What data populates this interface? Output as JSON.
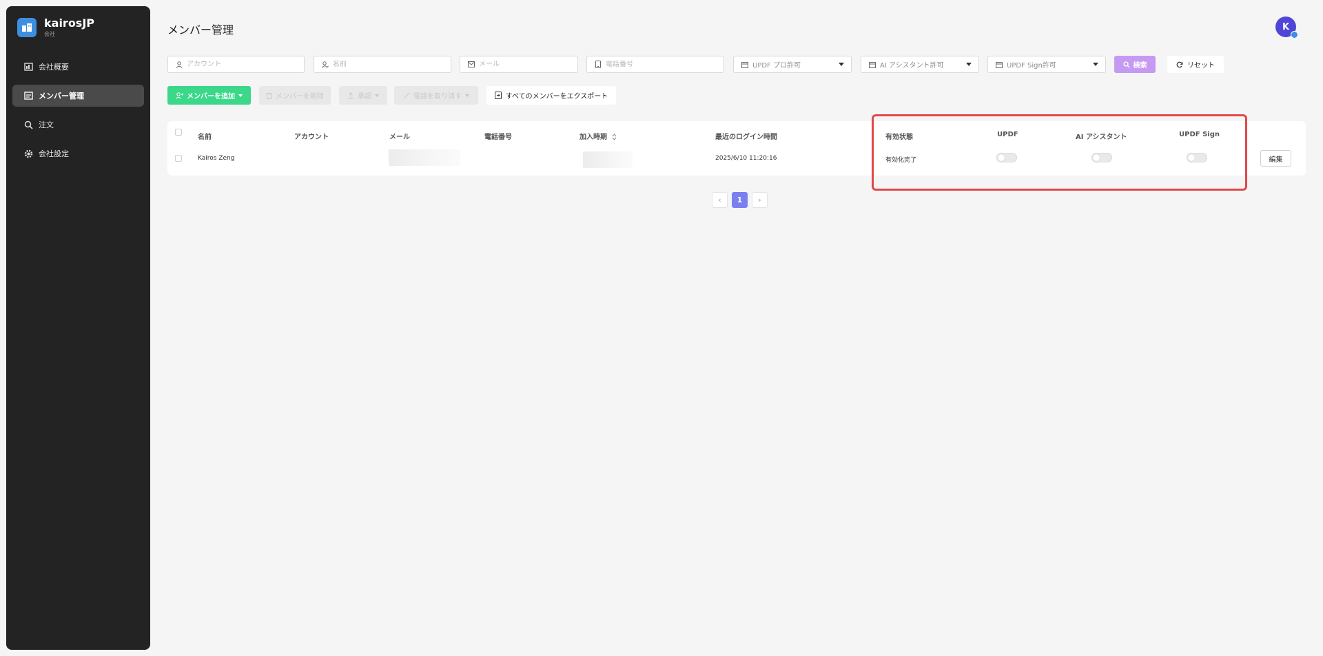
{
  "sidebar": {
    "brand_name": "kairosJP",
    "brand_sub": "会社",
    "items": [
      {
        "label": "会社概要",
        "icon": "chart-icon",
        "active": false
      },
      {
        "label": "メンバー管理",
        "icon": "members-icon",
        "active": true
      },
      {
        "label": "注文",
        "icon": "search-list-icon",
        "active": false
      },
      {
        "label": "会社設定",
        "icon": "gear-icon",
        "active": false
      }
    ]
  },
  "header": {
    "title": "メンバー管理",
    "avatar_initial": "K"
  },
  "filters": {
    "account_placeholder": "アカウント",
    "name_placeholder": "名前",
    "email_placeholder": "メール",
    "phone_placeholder": "電話番号",
    "pro_select": "UPDF プロ許可",
    "ai_select": "AI アシスタント許可",
    "sign_select": "UPDF Sign許可",
    "search_label": "検索",
    "reset_label": "リセット"
  },
  "actions": {
    "add_member": "メンバーを追加",
    "delete_member": "メンバーを削除",
    "approve": "承認",
    "remove_device": "電話を取り消す",
    "export_all": "すべてのメンバーをエクスポート"
  },
  "table": {
    "columns": {
      "name": "名前",
      "account": "アカウント",
      "email": "メール",
      "phone": "電話番号",
      "joined": "加入時期",
      "last_login": "最近のログイン時間",
      "status": "有効状態",
      "updf": "UPDF",
      "ai": "AI アシスタント",
      "sign": "UPDF Sign"
    },
    "rows": [
      {
        "name": "Kairos Zeng",
        "account": "",
        "last_login": "2025/6/10 11:20:16",
        "status": "有効化完了",
        "updf": false,
        "ai": false,
        "sign": false,
        "edit_label": "編集"
      }
    ]
  },
  "pagination": {
    "current": "1",
    "prev": "‹",
    "next": "›"
  },
  "colors": {
    "accent_green": "#3bd88a",
    "accent_purple": "#c69af2",
    "page_active": "#7b7ff0",
    "highlight_red": "#e04848"
  }
}
